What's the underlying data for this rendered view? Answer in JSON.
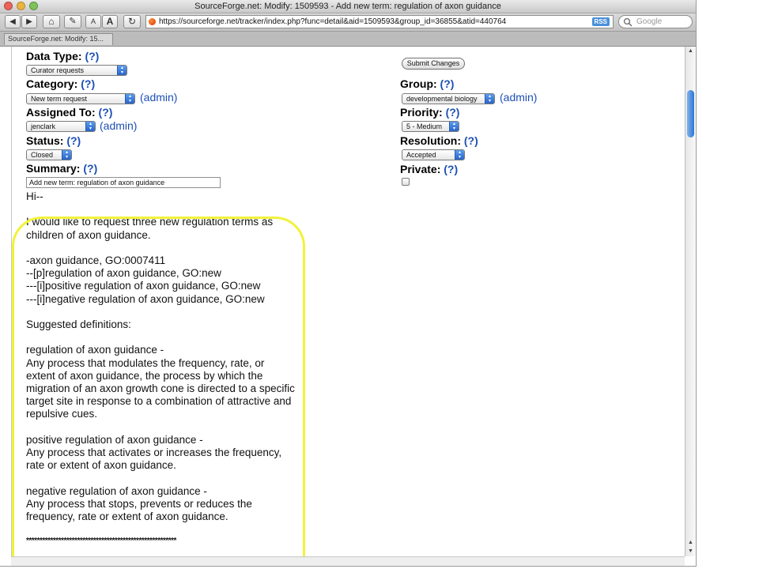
{
  "window": {
    "title": "SourceForge.net: Modify: 1509593 - Add new term: regulation of axon guidance"
  },
  "toolbar": {
    "back": "◀",
    "forward": "▶",
    "home": "⌂",
    "edit": "✎",
    "text_small": "A",
    "text_large": "A",
    "reload": "↻",
    "url": "https://sourceforge.net/tracker/index.php?func=detail&aid=1509593&group_id=36855&atid=440764",
    "rss": "RSS",
    "search_placeholder": "Google"
  },
  "tab": {
    "label": "SourceForge.net: Modify: 15..."
  },
  "form": {
    "help": "(?)",
    "admin": "(admin)",
    "data_type": {
      "label": "Data Type:",
      "value": "Curator requests"
    },
    "category": {
      "label": "Category:",
      "value": "New term request"
    },
    "assigned_to": {
      "label": "Assigned To:",
      "value": "jenclark"
    },
    "status": {
      "label": "Status:",
      "value": "Closed"
    },
    "summary": {
      "label": "Summary:",
      "value": "Add new term: regulation of axon guidance"
    },
    "submit_label": "Submit Changes",
    "group": {
      "label": "Group:",
      "value": "developmental biology"
    },
    "priority": {
      "label": "Priority:",
      "value": "5 - Medium"
    },
    "resolution": {
      "label": "Resolution:",
      "value": "Accepted"
    },
    "private": {
      "label": "Private:"
    }
  },
  "details": {
    "text": "Hi--\n\nI would like to request three new regulation terms as children of axon guidance.\n\n-axon guidance, GO:0007411\n--[p]regulation of axon guidance, GO:new\n---[i]positive regulation of axon guidance, GO:new\n---[i]negative regulation of axon guidance, GO:new\n\nSuggested definitions:\n\nregulation of axon guidance -\nAny process that modulates the frequency, rate, or extent of axon guidance, the process by which the migration of an axon growth cone is directed to a specific target site in response to a combination of attractive and repulsive cues.\n\npositive regulation of axon guidance -\nAny process that activates or increases the frequency, rate or extent of axon guidance.\n\nnegative regulation of axon guidance -\nAny process that stops, prevents or reduces the frequency, rate or extent of axon guidance.",
    "separator": "********************************************************"
  },
  "colors": {
    "highlight": "#f2f23a",
    "help_link": "#1d4fb5"
  }
}
